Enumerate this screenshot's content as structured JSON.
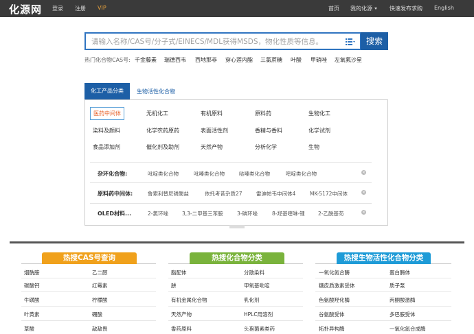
{
  "topbar": {
    "logo": "化源网",
    "login": "登录",
    "register": "注册",
    "vip": "VIP",
    "home": "首页",
    "my_chemsrc": "我的化源",
    "quick_post": "快速发布求购",
    "english": "English"
  },
  "search": {
    "placeholder": "请输入名称/CAS号/分子式/EINECS/MDL获得MSDS，物化性质等信息。",
    "button": "搜索",
    "hot_label": "热门化合物CAS号:",
    "hot_terms": [
      "千金藤素",
      "瑞德西韦",
      "西地那非",
      "穿心莲内酯",
      "三氯蔗糖",
      "叶酸",
      "甲硝唑",
      "左氧氟沙星"
    ]
  },
  "tabs": {
    "active": "化工产品分类",
    "other": "生物活性化合物"
  },
  "categories": [
    [
      "医药中间体",
      "无机化工",
      "有机原料",
      "原料药",
      "生物化工"
    ],
    [
      "染料及颜料",
      "化学农药原药",
      "表面活性剂",
      "香精与香料",
      "化学试剂"
    ],
    [
      "食品添加剂",
      "催化剂及助剂",
      "天然产物",
      "分析化学",
      "生物"
    ]
  ],
  "subcategories": [
    {
      "label": "杂环化合物:",
      "items": [
        "吡啶类化合物",
        "吡嗪类化合物",
        "哒嗪类化合物",
        "嘧啶类化合物"
      ]
    },
    {
      "label": "原料药中间体:",
      "items": [
        "鲁索利替尼磷酸盐",
        "依托考昔杂质27",
        "雷迪帕韦中间体4",
        "MK-5172中间体"
      ]
    },
    {
      "label": "OLED材料...",
      "items": [
        "2-氯环唑",
        "3,3-二甲基三苯胺",
        "3-碘环唑",
        "8-羟基喹啉-锂",
        "2-乙酰基芴"
      ]
    }
  ],
  "sections": [
    {
      "title": "热搜CAS号查询",
      "color": "#f0a11c",
      "rows": [
        [
          "烟酰胺",
          "乙二醇"
        ],
        [
          "碳酸钙",
          "红霉素"
        ],
        [
          "牛磺酸",
          "柠檬酸"
        ],
        [
          "叶黄素",
          "硼酸"
        ],
        [
          "草酸",
          "敌敌畏"
        ]
      ]
    },
    {
      "title": "热搜化合物分类",
      "color": "#7ab33c",
      "rows": [
        [
          "脂配体",
          "分散染料"
        ],
        [
          "肼",
          "甲氧基吡啶"
        ],
        [
          "有机金属化合物",
          "乳化剂"
        ],
        [
          "天然产物",
          "HPLC用溶剂"
        ],
        [
          "香药原料",
          "头孢菌素类药"
        ]
      ]
    },
    {
      "title": "热搜生物活性化合物分类",
      "color": "#1e9bd7",
      "rows": [
        [
          "一氧化氮合酶",
          "蛋白酶体"
        ],
        [
          "糖皮质激素受体",
          "质子泵"
        ],
        [
          "色氨酸羟化酶",
          "丙酮酸激酶"
        ],
        [
          "谷氨酸受体",
          "多巴胺受体"
        ],
        [
          "拓扑异构酶",
          "一氧化氮合成酶"
        ]
      ]
    }
  ]
}
